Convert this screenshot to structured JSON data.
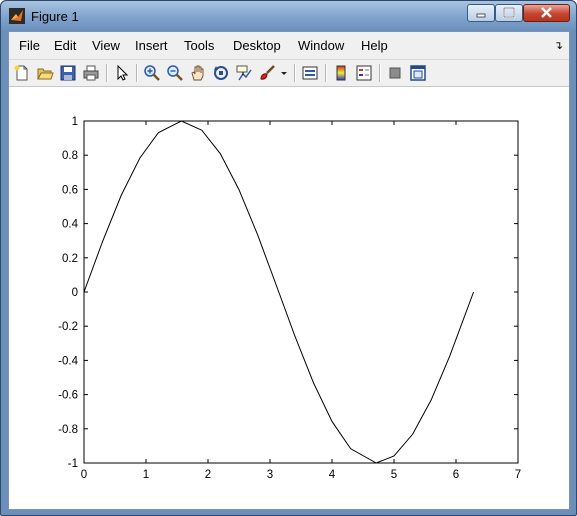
{
  "window": {
    "title": "Figure 1",
    "buttons": [
      "minimize",
      "maximize",
      "close"
    ]
  },
  "menubar": {
    "items": [
      "File",
      "Edit",
      "View",
      "Insert",
      "Tools",
      "Desktop",
      "Window",
      "Help"
    ],
    "overflow_icon": "chevron-icon"
  },
  "toolbar": {
    "icons": [
      "new-figure-icon",
      "open-file-icon",
      "save-icon",
      "print-icon",
      "edit-plot-arrow-icon",
      "zoom-in-icon",
      "zoom-out-icon",
      "pan-hand-icon",
      "rotate-3d-icon",
      "data-cursor-icon",
      "brush-icon",
      "brush-dropdown-icon",
      "link-plot-icon",
      "insert-colorbar-icon",
      "insert-legend-icon",
      "hide-plot-tools-icon",
      "show-plot-tools-icon"
    ]
  },
  "colors": {
    "titlebar": "#7fa3cc",
    "close_button": "#c4452e",
    "plot_line": "#000000"
  },
  "chart_data": {
    "type": "line",
    "title": "",
    "xlabel": "",
    "ylabel": "",
    "xlim": [
      0,
      7
    ],
    "ylim": [
      -1,
      1
    ],
    "xticks": [
      0,
      1,
      2,
      3,
      4,
      5,
      6,
      7
    ],
    "yticks": [
      -1,
      -0.8,
      -0.6,
      -0.4,
      -0.2,
      0,
      0.2,
      0.4,
      0.6,
      0.8,
      1
    ],
    "xtick_labels": [
      "0",
      "1",
      "2",
      "3",
      "4",
      "5",
      "6",
      "7"
    ],
    "ytick_labels": [
      "-1",
      "-0.8",
      "-0.6",
      "-0.4",
      "-0.2",
      "0",
      "0.2",
      "0.4",
      "0.6",
      "0.8",
      "1"
    ],
    "grid": false,
    "series": [
      {
        "color": "#000000",
        "x": [
          0,
          0.3,
          0.6,
          0.9,
          1.2,
          1.5708,
          1.9,
          2.2,
          2.5,
          2.8,
          3.1416,
          3.4,
          3.7,
          4.0,
          4.3,
          4.7124,
          5.0,
          5.3,
          5.6,
          5.9,
          6.2832
        ],
        "y": [
          0,
          0.296,
          0.565,
          0.783,
          0.932,
          1.0,
          0.946,
          0.808,
          0.598,
          0.335,
          0.0,
          -0.256,
          -0.53,
          -0.757,
          -0.916,
          -1.0,
          -0.959,
          -0.832,
          -0.631,
          -0.374,
          0.0
        ]
      }
    ]
  }
}
